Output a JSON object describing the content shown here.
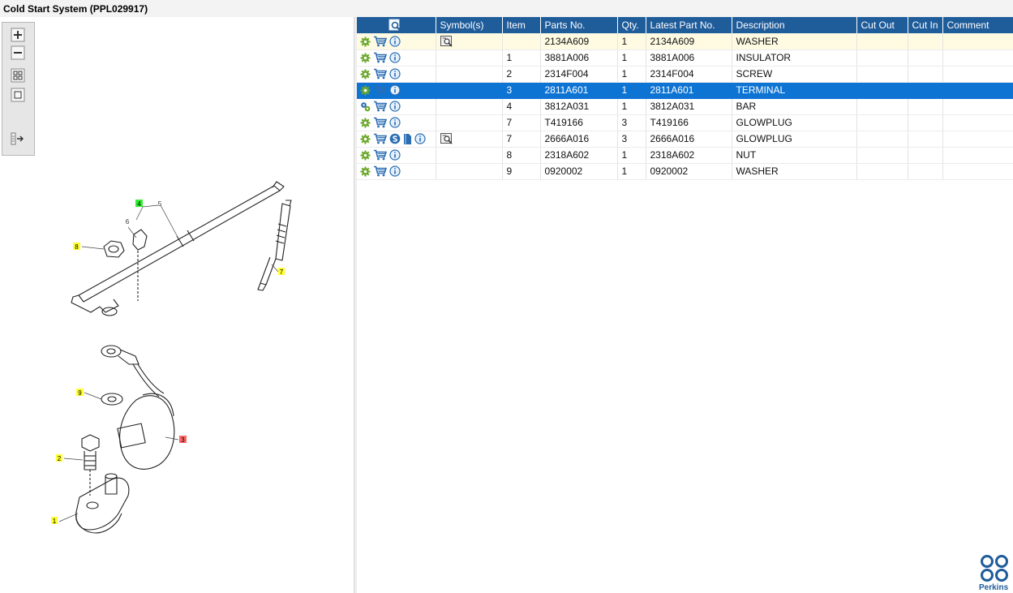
{
  "window": {
    "title": "Cold Start System (PPL029917)"
  },
  "toolbar": {
    "buttons": [
      {
        "icon": "zoom-in-icon"
      },
      {
        "icon": "zoom-out-icon"
      },
      {
        "icon": "fit-all-icon"
      },
      {
        "icon": "actual-size-icon"
      },
      {
        "icon": "toggle-panel-icon"
      }
    ]
  },
  "diagram": {
    "callouts": [
      {
        "label": "1",
        "color": "#ffff33"
      },
      {
        "label": "2",
        "color": "#ffff33"
      },
      {
        "label": "3",
        "color": "#ff6666"
      },
      {
        "label": "4",
        "color": "#33ee33"
      },
      {
        "label": "5",
        "color": "#ffffff"
      },
      {
        "label": "6",
        "color": "#ffffff"
      },
      {
        "label": "7",
        "color": "#ffff33"
      },
      {
        "label": "8",
        "color": "#ffff33"
      },
      {
        "label": "9",
        "color": "#ffff33"
      }
    ]
  },
  "table": {
    "columns": [
      "Symbol(s)",
      "Item",
      "Parts No.",
      "Qty.",
      "Latest Part No.",
      "Description",
      "Cut Out",
      "Cut In",
      "Comment"
    ],
    "rows": [
      {
        "icons": [
          "gear-icon",
          "cart-icon",
          "info-icon"
        ],
        "symbol": "doc-search-icon",
        "item": "",
        "part_no": "2134A609",
        "qty": "1",
        "latest": "2134A609",
        "desc": "WASHER",
        "state": "highlight"
      },
      {
        "icons": [
          "gear-icon",
          "cart-icon",
          "info-icon"
        ],
        "symbol": "",
        "item": "1",
        "part_no": "3881A006",
        "qty": "1",
        "latest": "3881A006",
        "desc": "INSULATOR",
        "state": ""
      },
      {
        "icons": [
          "gear-icon",
          "cart-icon",
          "info-icon"
        ],
        "symbol": "",
        "item": "2",
        "part_no": "2314F004",
        "qty": "1",
        "latest": "2314F004",
        "desc": "SCREW",
        "state": ""
      },
      {
        "icons": [
          "gear-icon",
          "cart-icon",
          "info-icon"
        ],
        "symbol": "",
        "item": "3",
        "part_no": "2811A601",
        "qty": "1",
        "latest": "2811A601",
        "desc": "TERMINAL",
        "state": "selected"
      },
      {
        "icons": [
          "gears-icon",
          "cart-icon",
          "info-icon"
        ],
        "symbol": "",
        "item": "4",
        "part_no": "3812A031",
        "qty": "1",
        "latest": "3812A031",
        "desc": "BAR",
        "state": ""
      },
      {
        "icons": [
          "gear-icon",
          "cart-icon",
          "info-icon"
        ],
        "symbol": "",
        "item": "7",
        "part_no": "T419166",
        "qty": "3",
        "latest": "T419166",
        "desc": "GLOWPLUG",
        "state": ""
      },
      {
        "icons": [
          "gear-icon",
          "cart-icon",
          "service-icon",
          "document-icon",
          "info-icon"
        ],
        "symbol": "doc-search-icon",
        "item": "7",
        "part_no": "2666A016",
        "qty": "3",
        "latest": "2666A016",
        "desc": "GLOWPLUG",
        "state": ""
      },
      {
        "icons": [
          "gear-icon",
          "cart-icon",
          "info-icon"
        ],
        "symbol": "",
        "item": "8",
        "part_no": "2318A602",
        "qty": "1",
        "latest": "2318A602",
        "desc": "NUT",
        "state": ""
      },
      {
        "icons": [
          "gear-icon",
          "cart-icon",
          "info-icon"
        ],
        "symbol": "",
        "item": "9",
        "part_no": "0920002",
        "qty": "1",
        "latest": "0920002",
        "desc": "WASHER",
        "state": ""
      }
    ]
  },
  "brand": {
    "name": "Perkins",
    "color": "#1f5c9a"
  },
  "colors": {
    "header_bg": "#1f5c9a",
    "selected_bg": "#0e74d4",
    "highlight_bg": "#fffbe3",
    "gear_green": "#6aa82a",
    "cart_blue": "#2a6db3"
  }
}
